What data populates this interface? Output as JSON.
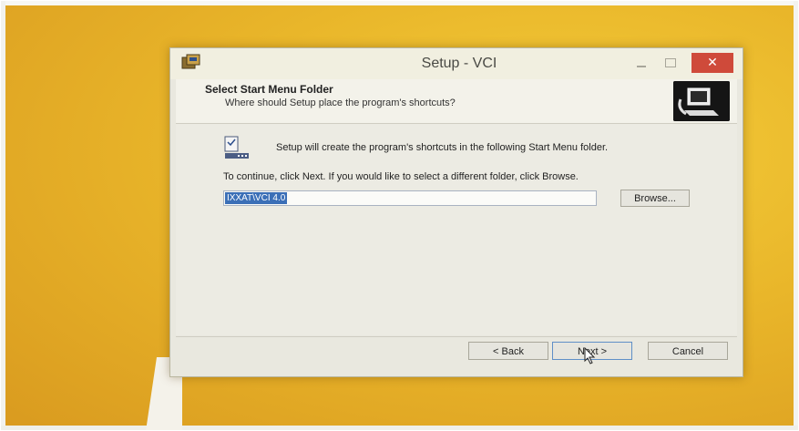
{
  "window": {
    "title": "Setup - VCI",
    "close_glyph": "✕"
  },
  "header": {
    "title": "Select Start Menu Folder",
    "subtitle": "Where should Setup place the program's shortcuts?"
  },
  "content": {
    "info_line": "Setup will create the program's shortcuts in the following Start Menu folder.",
    "instruction_line": "To continue, click Next. If you would like to select a different folder, click Browse.",
    "folder_value": "IXXAT\\VCI 4.0",
    "browse_label": "Browse..."
  },
  "footer": {
    "back_label": "< Back",
    "next_label": "Next >",
    "cancel_label": "Cancel"
  },
  "icons": {
    "app": "setup-app-icon",
    "header": "computer-setup-icon",
    "folder": "start-menu-folder-icon",
    "cursor": "mouse-pointer-icon"
  },
  "colors": {
    "desktop": "#e9b62a",
    "close_button": "#cf4a3a",
    "selection": "#3b6fb7"
  }
}
